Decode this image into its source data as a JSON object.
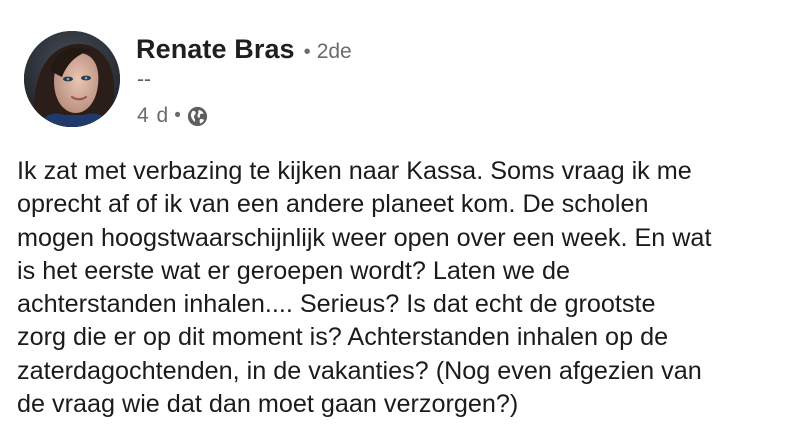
{
  "author": {
    "name": "Renate Bras",
    "connection_degree": "2de",
    "headline": "--"
  },
  "meta": {
    "timestamp": "4 d",
    "separator": "•",
    "visibility_icon": "globe-icon"
  },
  "post": {
    "text": "Ik zat met verbazing te kijken naar Kassa. Soms vraag ik me\noprecht af of ik van een andere planeet kom. De scholen\nmogen hoogstwaarschijnlijk weer open over een week. En wat\nis het eerste wat er geroepen wordt? Laten we de\nachterstanden inhalen.... Serieus? Is dat echt de grootste\nzorg die er op dit moment is? Achterstanden inhalen op de\nzaterdagochtenden, in de vakanties? (Nog even afgezien van\nde vraag wie dat dan moet gaan verzorgen?)"
  },
  "colors": {
    "text_primary": "#1b1b1b",
    "text_secondary": "#6b6b6b",
    "background": "#ffffff"
  }
}
